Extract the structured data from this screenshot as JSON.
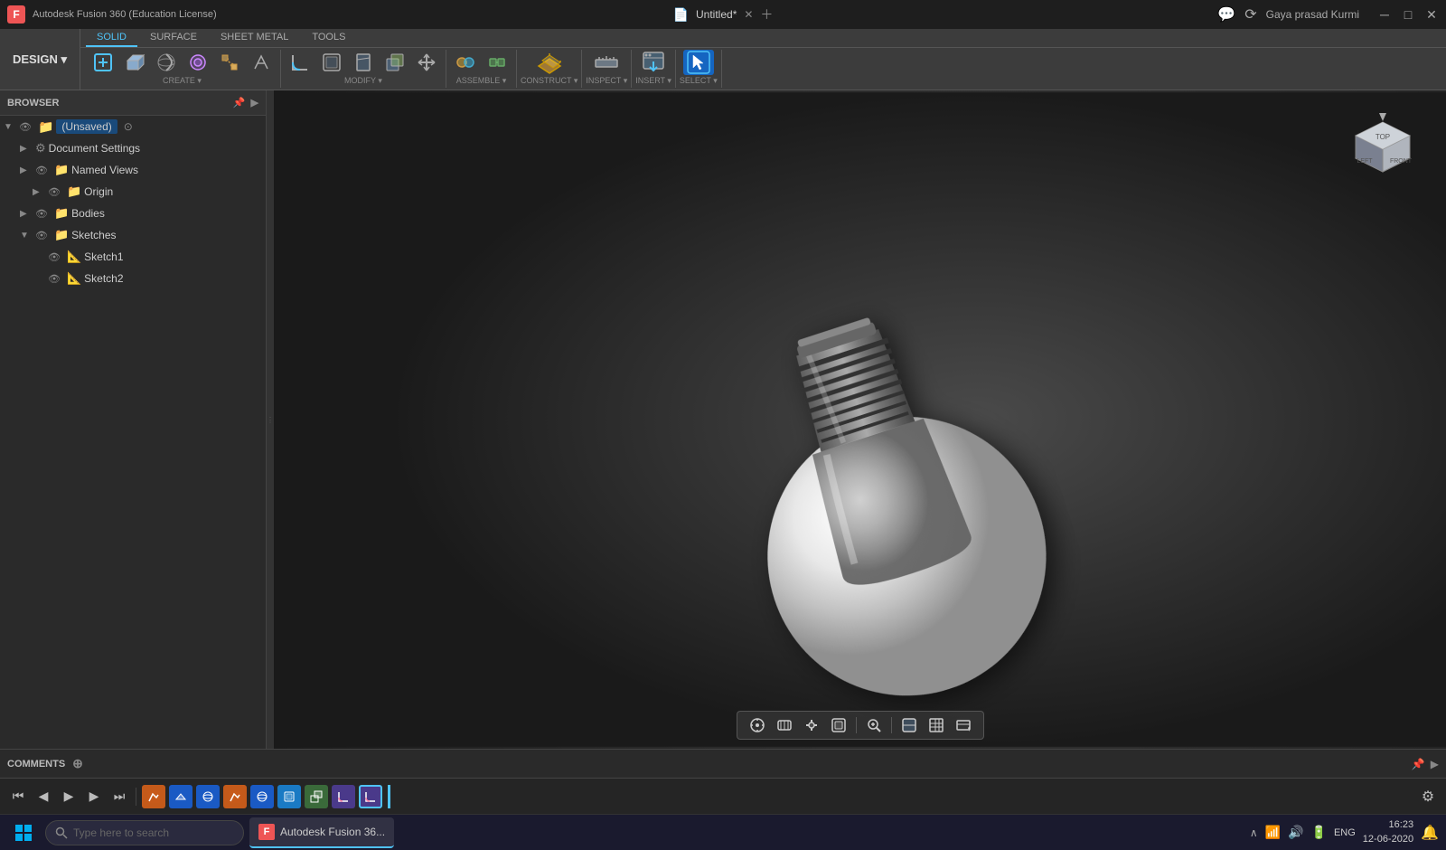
{
  "app": {
    "title": "Autodesk Fusion 360 (Education License)",
    "icon": "F"
  },
  "titlebar": {
    "title": "Autodesk Fusion 360 (Education License)",
    "document_title": "Untitled*",
    "user": "Gaya prasad Kurmi",
    "minimize_label": "─",
    "maximize_label": "□",
    "close_label": "✕",
    "plus_label": "＋",
    "comment_icon": "💬",
    "share_icon": "↗",
    "account_icon": "👤"
  },
  "toolbar": {
    "design_label": "DESIGN ▾",
    "tabs": [
      "SOLID",
      "SURFACE",
      "SHEET METAL",
      "TOOLS"
    ],
    "active_tab": "SOLID",
    "groups": {
      "create": {
        "label": "CREATE ▾",
        "buttons": [
          "✚",
          "◻",
          "◕",
          "⬤",
          "⊞",
          "✦"
        ]
      },
      "modify": {
        "label": "MODIFY ▾",
        "buttons": [
          "↗",
          "↙",
          "◱",
          "◧",
          "✛"
        ]
      },
      "assemble": {
        "label": "ASSEMBLE ▾",
        "buttons": [
          "⚙",
          "🔗"
        ]
      },
      "construct": {
        "label": "CONSTRUCT ▾",
        "buttons": [
          "📐"
        ]
      },
      "inspect": {
        "label": "INSPECT ▾",
        "buttons": [
          "📏"
        ]
      },
      "insert": {
        "label": "INSERT ▾",
        "buttons": [
          "📷"
        ]
      },
      "select": {
        "label": "SELECT ▾",
        "buttons": [
          "◻"
        ],
        "active": true
      }
    }
  },
  "browser": {
    "title": "BROWSER",
    "items": [
      {
        "id": "unsaved",
        "label": "(Unsaved)",
        "level": 0,
        "expanded": true,
        "type": "root"
      },
      {
        "id": "doc-settings",
        "label": "Document Settings",
        "level": 1,
        "expanded": false,
        "type": "settings"
      },
      {
        "id": "named-views",
        "label": "Named Views",
        "level": 1,
        "expanded": false,
        "type": "folder"
      },
      {
        "id": "origin",
        "label": "Origin",
        "level": 2,
        "expanded": false,
        "type": "folder"
      },
      {
        "id": "bodies",
        "label": "Bodies",
        "level": 1,
        "expanded": false,
        "type": "folder"
      },
      {
        "id": "sketches",
        "label": "Sketches",
        "level": 1,
        "expanded": true,
        "type": "folder"
      },
      {
        "id": "sketch1",
        "label": "Sketch1",
        "level": 2,
        "type": "sketch"
      },
      {
        "id": "sketch2",
        "label": "Sketch2",
        "level": 2,
        "type": "sketch"
      }
    ]
  },
  "comments": {
    "title": "COMMENTS"
  },
  "timeline": {
    "items": [
      {
        "type": "sketch",
        "label": "S"
      },
      {
        "type": "extrude",
        "label": "E"
      },
      {
        "type": "revolve",
        "label": "R"
      },
      {
        "type": "sketch",
        "label": "S"
      },
      {
        "type": "revolve",
        "label": "R"
      },
      {
        "type": "shell",
        "label": "Sh"
      },
      {
        "type": "combine",
        "label": "C"
      },
      {
        "type": "fillet",
        "label": "F"
      },
      {
        "type": "fillet",
        "label": "F"
      }
    ],
    "controls": {
      "first": "⏮",
      "prev": "◀",
      "play": "▶",
      "next": "▶",
      "last": "⏭"
    }
  },
  "viewport_toolbar": {
    "snap": "🧲",
    "orbit": "↻",
    "pan": "✋",
    "zoom_fit": "⊡",
    "zoom_window": "🔍",
    "display": "◻",
    "grid": "⊞",
    "more": "⋯"
  },
  "taskbar": {
    "search_placeholder": "Type here to search",
    "app_label": "Autodesk Fusion 36...",
    "time": "16:23",
    "date": "12-06-2020",
    "lang": "ENG",
    "start_icon": "⊞"
  }
}
